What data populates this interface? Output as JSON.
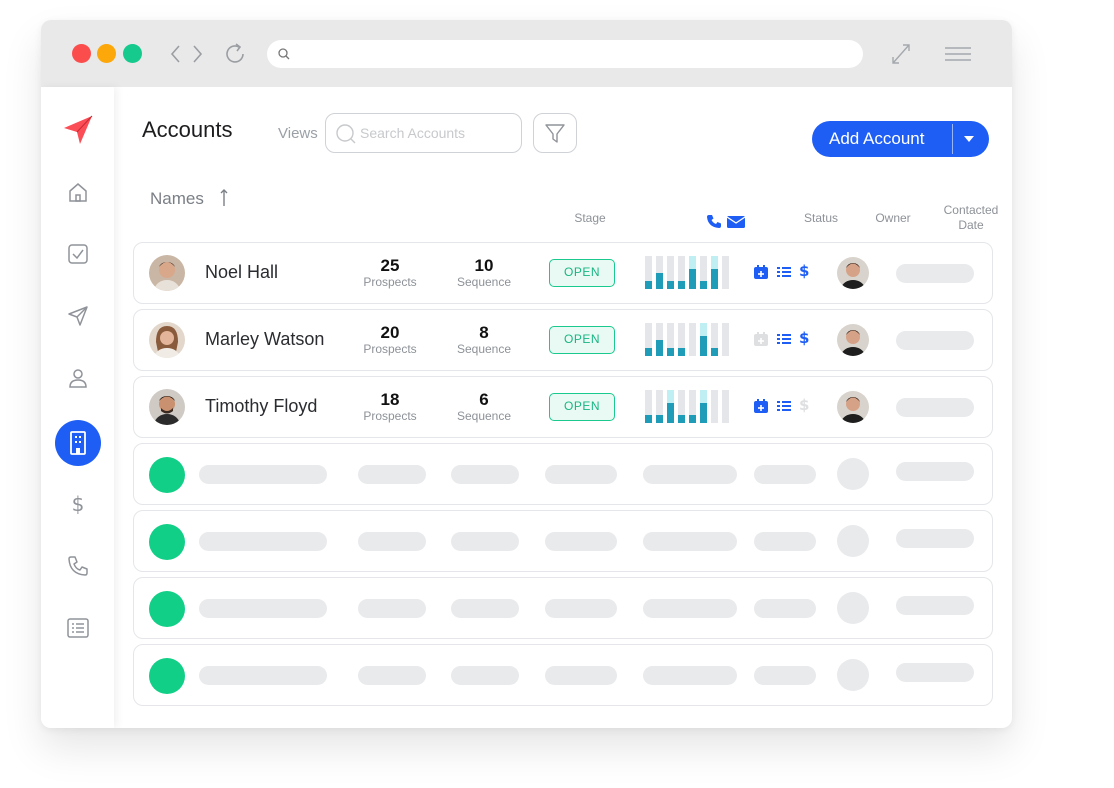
{
  "header": {
    "title": "Accounts",
    "views_label": "Views",
    "search_placeholder": "Search Accounts",
    "add_button": "Add Account"
  },
  "columns": {
    "names": "Names",
    "stage": "Stage",
    "status": "Status",
    "owner": "Owner",
    "contacted_line1": "Contacted",
    "contacted_line2": "Date"
  },
  "rows": [
    {
      "name": "Noel Hall",
      "prospects": "25",
      "prospects_label": "Prospects",
      "sequence": "10",
      "sequence_label": "Sequence",
      "stage": "OPEN"
    },
    {
      "name": "Marley Watson",
      "prospects": "20",
      "prospects_label": "Prospects",
      "sequence": "8",
      "sequence_label": "Sequence",
      "stage": "OPEN"
    },
    {
      "name": "Timothy Floyd",
      "prospects": "18",
      "prospects_label": "Prospects",
      "sequence": "6",
      "sequence_label": "Sequence",
      "stage": "OPEN"
    }
  ],
  "sidebar": {
    "items": [
      "logo-send-icon",
      "home-icon",
      "tasks-checkbox-icon",
      "send-icon",
      "contact-person-icon",
      "accounts-building-icon",
      "deals-dollar-icon",
      "calls-phone-icon",
      "reports-list-icon"
    ],
    "active": "accounts-building-icon"
  },
  "colors": {
    "accent": "#1f5ef5",
    "open_badge": "#19c98e",
    "placeholder_dot": "#11cf86",
    "chart_bar": "#1f9cb7"
  }
}
